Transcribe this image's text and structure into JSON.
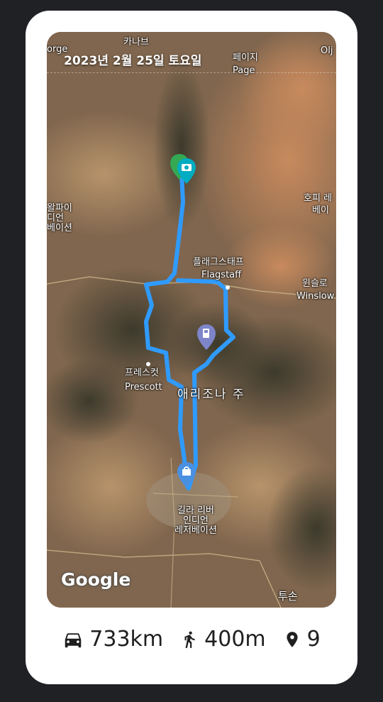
{
  "date_label": "2023년 2월 25일 토요일",
  "map": {
    "places": {
      "kanab_ko": "카나브",
      "page_ko": "페이지",
      "page_en": "Page",
      "oljato": "Olj",
      "gorge": "orge",
      "hopi_ko": "호피 레",
      "hopi_ko2": "베이",
      "hualapai_ko": "왈파이\n디언\n베이션",
      "flagstaff_ko": "플래그스태프",
      "flagstaff_en": "Flagstaff",
      "winslow_ko": "윈슬로",
      "winslow_en": "Winslow",
      "prescott_ko": "프레스컷",
      "prescott_en": "Prescott",
      "arizona": "애리조나 주",
      "gila_ko": "길라 리버\n인디언\n레저베이션",
      "tucson_ko": "투손",
      "google": "Google"
    },
    "pins": [
      {
        "name": "camera-pin-icon",
        "color": "#00acc1"
      },
      {
        "name": "gas-station-pin-icon",
        "color": "#7e85c9"
      },
      {
        "name": "shopping-pin-icon",
        "color": "#4a90e2"
      }
    ],
    "route_color": "#2f9bff"
  },
  "stats": {
    "drive": "733km",
    "walk": "400m",
    "places": "9"
  }
}
